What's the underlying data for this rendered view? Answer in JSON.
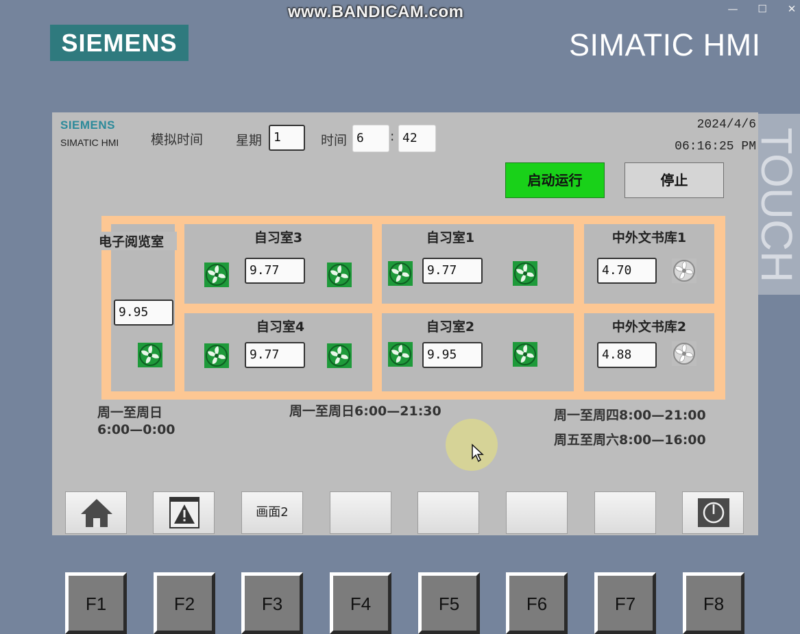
{
  "overlay": {
    "watermark": "www.BANDICAM.com"
  },
  "window": {
    "minimize": "—",
    "maximize": "☐",
    "close": "✕"
  },
  "panel": {
    "brand_logo": "SIEMENS",
    "brand_title": "SIMATIC HMI",
    "side_text": "TOUCH"
  },
  "screen": {
    "logo": "SIEMENS",
    "logo_sub": "SIMATIC HMI",
    "sim_time_label": "模拟时间",
    "weekday_label": "星期",
    "weekday_value": "1",
    "time_label": "时间",
    "hour_value": "6",
    "colon": ":",
    "minute_value": "42",
    "date": "2024/4/6",
    "clock": "06:16:25 PM",
    "start_button": "启动运行",
    "stop_button": "停止",
    "accent_colors": {
      "running_green": "#19d119",
      "frame_orange": "#fdc793",
      "fan_green": "#1e9a3a"
    },
    "rooms": {
      "ereading": {
        "name": "电子阅览室",
        "value": "9.95",
        "fans": [
          "on"
        ]
      },
      "study3": {
        "name": "自习室3",
        "value": "9.77",
        "fans": [
          "on",
          "on"
        ]
      },
      "study1": {
        "name": "自习室1",
        "value": "9.77",
        "fans": [
          "on",
          "on"
        ]
      },
      "library1": {
        "name": "中外文书库1",
        "value": "4.70",
        "fans": [
          "off"
        ]
      },
      "study4": {
        "name": "自习室4",
        "value": "9.77",
        "fans": [
          "on",
          "on"
        ]
      },
      "study2": {
        "name": "自习室2",
        "value": "9.95",
        "fans": [
          "on",
          "on"
        ]
      },
      "library2": {
        "name": "中外文书库2",
        "value": "4.88",
        "fans": [
          "off"
        ]
      }
    },
    "schedules": {
      "ereading_line1": "周一至周日",
      "ereading_line2": "6:00—0:00",
      "study": "周一至周日6:00—21:30",
      "library_line1": "周一至周四8:00—21:00",
      "library_line2": "周五至周六8:00—16:00"
    },
    "nav": {
      "home_icon": "home-icon",
      "alarm_icon": "alarm-warning-icon",
      "screen2_label": "画面2",
      "power_icon": "power-icon"
    }
  },
  "function_keys": [
    "F1",
    "F2",
    "F3",
    "F4",
    "F5",
    "F6",
    "F7",
    "F8"
  ]
}
